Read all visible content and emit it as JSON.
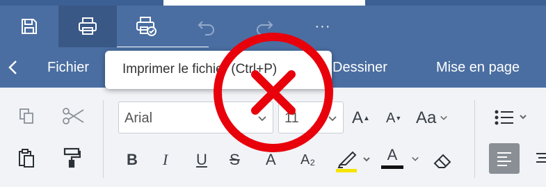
{
  "quick_access": {
    "save_icon": "save-icon",
    "print_icon": "printer-icon",
    "quick_print_icon": "quick-print-icon",
    "undo_icon": "undo-icon",
    "redo_icon": "redo-icon",
    "more_label": "···"
  },
  "menu": {
    "items": [
      "Fichier",
      "Dessiner",
      "Mise en page"
    ]
  },
  "tooltip": {
    "text": "Imprimer le fichier (Ctrl+P)"
  },
  "ribbon": {
    "font_name": "Arial",
    "font_size": "11",
    "bold_label": "B",
    "italic_label": "I",
    "underline_label": "U",
    "strike_label": "S",
    "superscript_label": "A",
    "subscript_label": "A₂",
    "grow_label": "A",
    "shrink_label": "A",
    "case_label": "Aa",
    "font_color_label": "A"
  },
  "colors": {
    "header_bg": "#4a6ea1",
    "active_bg": "#3a5886",
    "ribbon_bg": "#f1f3f6",
    "highlight": "#f5e400",
    "font_color_bar": "#111111",
    "overlay_red": "#e8000b"
  }
}
